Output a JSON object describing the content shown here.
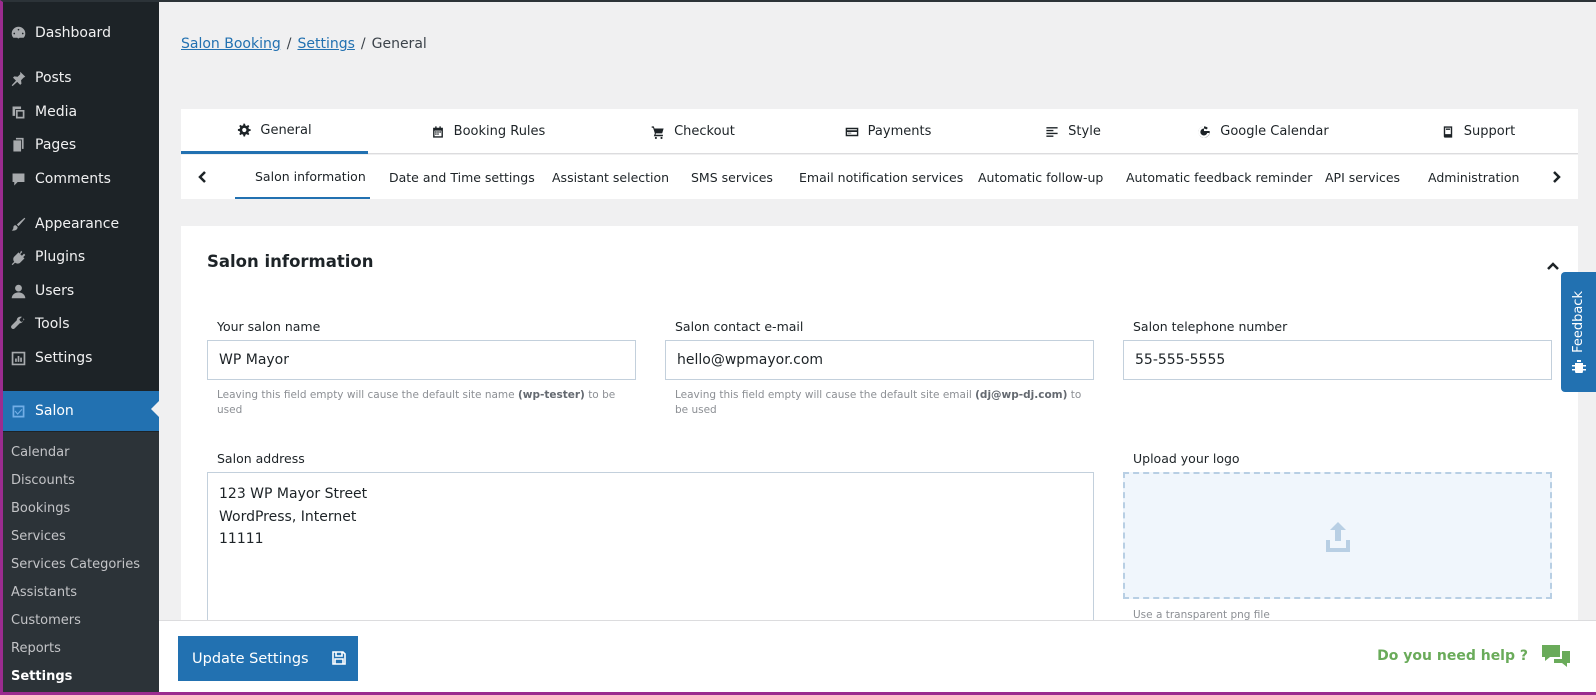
{
  "sidebar": {
    "items": [
      {
        "label": "Dashboard",
        "icon": "dashboard-icon"
      },
      {
        "label": "Posts",
        "icon": "pin-icon"
      },
      {
        "label": "Media",
        "icon": "media-icon"
      },
      {
        "label": "Pages",
        "icon": "pages-icon"
      },
      {
        "label": "Comments",
        "icon": "comment-icon"
      },
      {
        "label": "Appearance",
        "icon": "brush-icon"
      },
      {
        "label": "Plugins",
        "icon": "plug-icon"
      },
      {
        "label": "Users",
        "icon": "user-icon"
      },
      {
        "label": "Tools",
        "icon": "wrench-icon"
      },
      {
        "label": "Settings",
        "icon": "settings-icon"
      },
      {
        "label": "Salon",
        "icon": "salon-icon"
      }
    ],
    "submenu": [
      "Calendar",
      "Discounts",
      "Bookings",
      "Services",
      "Services Categories",
      "Assistants",
      "Customers",
      "Reports",
      "Settings"
    ]
  },
  "breadcrumb": {
    "items": [
      "Salon Booking",
      "Settings"
    ],
    "current": "General",
    "separator": "/"
  },
  "main_tabs": [
    {
      "label": "General",
      "icon": "gear-icon"
    },
    {
      "label": "Booking Rules",
      "icon": "calendar-icon"
    },
    {
      "label": "Checkout",
      "icon": "cart-icon"
    },
    {
      "label": "Payments",
      "icon": "credit-card-icon"
    },
    {
      "label": "Style",
      "icon": "align-left-icon"
    },
    {
      "label": "Google Calendar",
      "icon": "google-icon"
    },
    {
      "label": "Support",
      "icon": "book-icon"
    }
  ],
  "sub_tabs": [
    "Salon information",
    "Date and Time settings",
    "Assistant selection",
    "SMS services",
    "Email notification services",
    "Automatic follow-up",
    "Automatic feedback reminder",
    "API services",
    "Administration"
  ],
  "section": {
    "title": "Salon information",
    "salon_name": {
      "label": "Your salon name",
      "value": "WP Mayor",
      "hint_pre": "Leaving this field empty will cause the default site name",
      "hint_value": "(wp-tester)",
      "hint_post": "to be used"
    },
    "email": {
      "label": "Salon contact e-mail",
      "value": "hello@wpmayor.com",
      "hint_pre": "Leaving this field empty will cause the default site email",
      "hint_value": "(dj@wp-dj.com)",
      "hint_post": "to be used"
    },
    "phone": {
      "label": "Salon telephone number",
      "value": "55-555-5555"
    },
    "address": {
      "label": "Salon address",
      "value": "123 WP Mayor Street\nWordPress, Internet\n11111"
    },
    "logo": {
      "label": "Upload your logo",
      "hint": "Use a transparent png file"
    }
  },
  "feedback": {
    "label": "Feedback"
  },
  "footer": {
    "update_label": "Update Settings",
    "help_label": "Do you need help ?"
  },
  "colors": {
    "accent": "#2271b1",
    "sidebar_bg": "#1d2327",
    "help_green": "#6aab5a"
  }
}
